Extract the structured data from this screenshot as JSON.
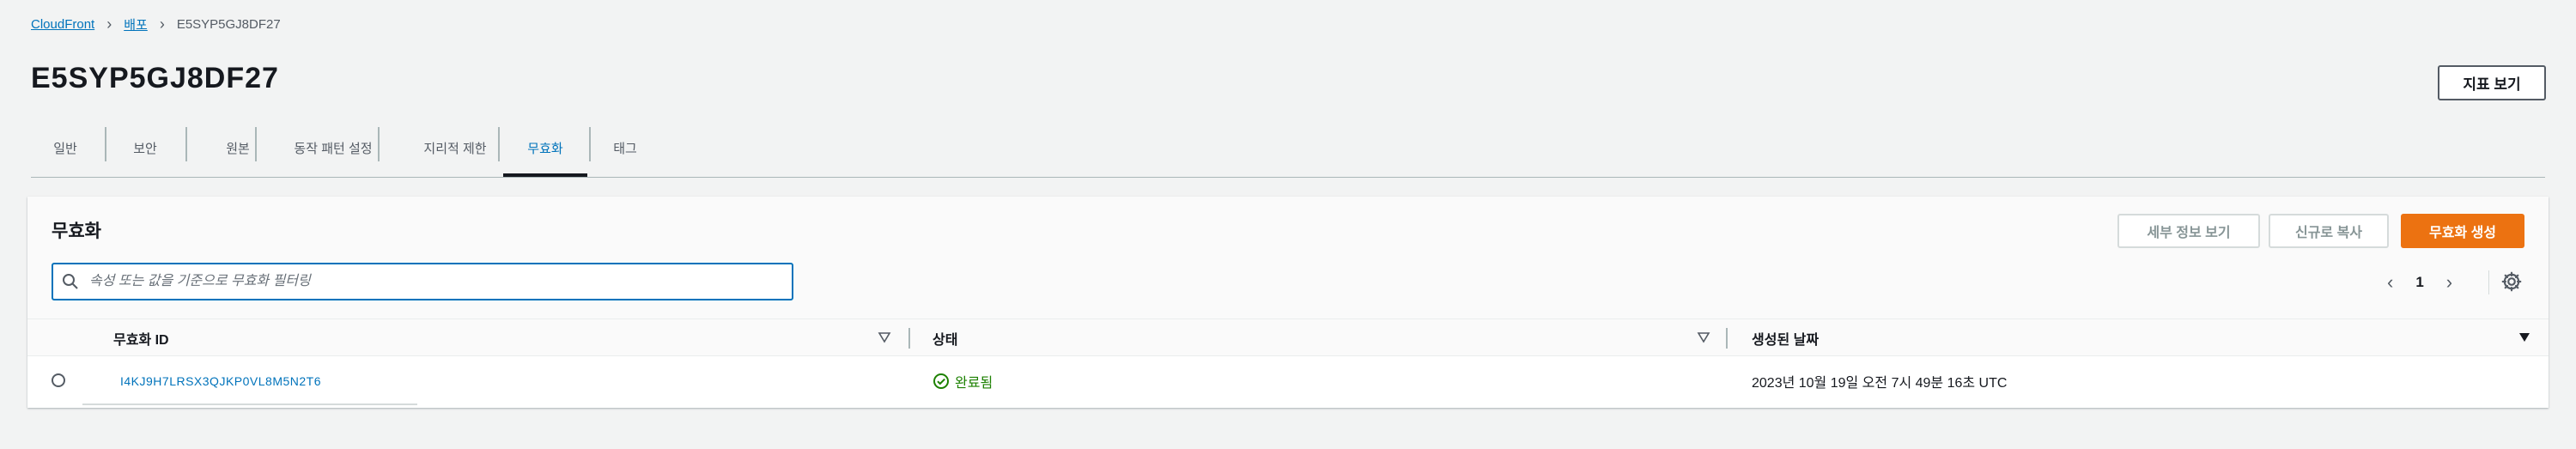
{
  "breadcrumb": {
    "items": [
      "CloudFront",
      "배포"
    ],
    "current": "E5SYP5GJ8DF27"
  },
  "page": {
    "title": "E5SYP5GJ8DF27",
    "metrics_button": "지표 보기"
  },
  "tabs": [
    {
      "label": "일반",
      "active": false
    },
    {
      "label": "보안",
      "active": false
    },
    {
      "label": "원본",
      "active": false
    },
    {
      "label": "동작 패턴 설정",
      "active": false
    },
    {
      "label": "지리적 제한",
      "active": false
    },
    {
      "label": "무효화",
      "active": true
    },
    {
      "label": "태그",
      "active": false
    }
  ],
  "panel": {
    "title": "무효화",
    "buttons": {
      "view_details": "세부 정보 보기",
      "copy_new": "신규로 복사",
      "create": "무효화 생성"
    },
    "search": {
      "placeholder": "속성 또는 값을 기준으로 무효화 필터링",
      "value": ""
    },
    "pagination": {
      "current_page": "1"
    },
    "table": {
      "columns": [
        "무효화 ID",
        "상태",
        "생성된 날짜"
      ],
      "rows": [
        {
          "id": "I4KJ9H7LRSX3QJKP0VL8M5N2T6",
          "status": "완료됨",
          "created": "2023년 10월 19일 오전 7시 49분 16초 UTC"
        }
      ]
    }
  },
  "colors": {
    "link": "#0073bb",
    "primary": "#ec7211",
    "success": "#1d8102"
  }
}
